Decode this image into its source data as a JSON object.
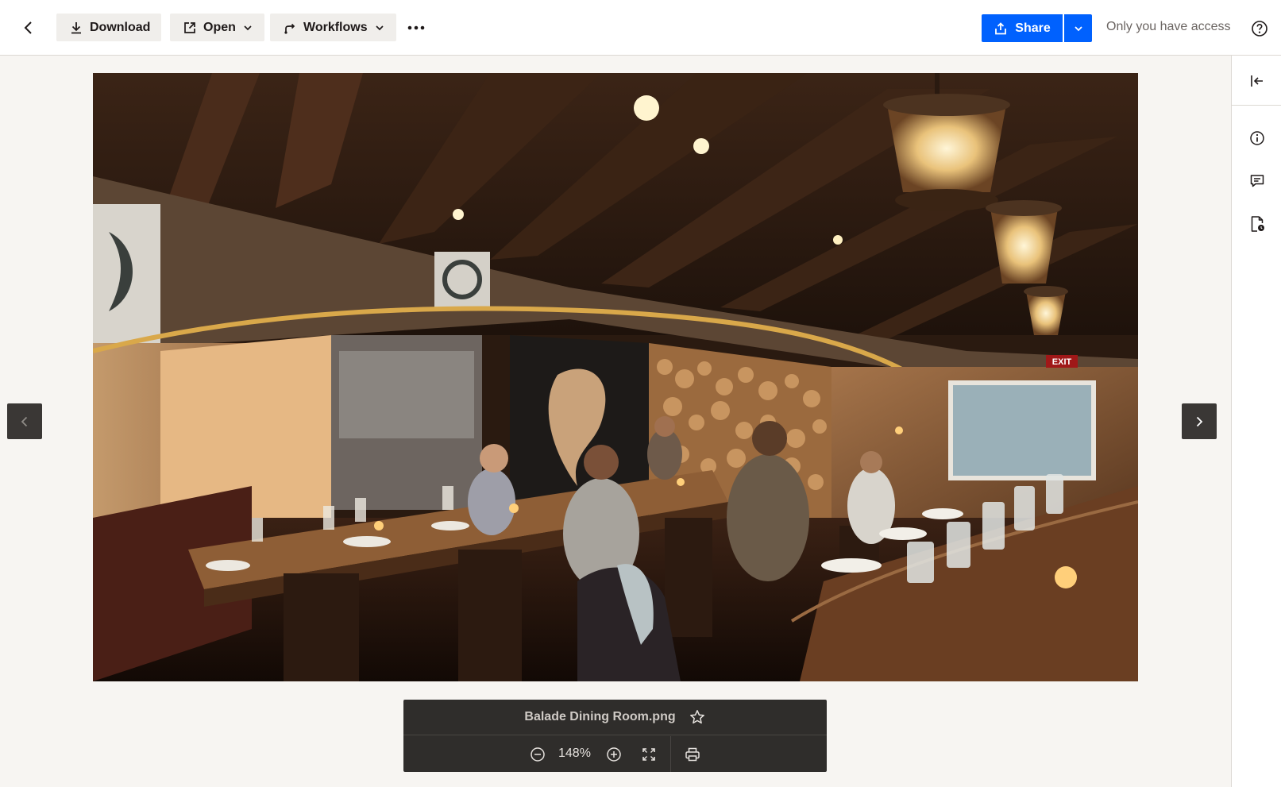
{
  "toolbar": {
    "download_label": "Download",
    "open_label": "Open",
    "workflows_label": "Workflows",
    "share_label": "Share",
    "access_text": "Only you have access"
  },
  "icons": {
    "back": "chevron-left-icon",
    "download": "download-icon",
    "open": "open-external-icon",
    "workflows": "workflows-icon",
    "more": "more-horizontal-icon",
    "share": "share-upload-icon",
    "help": "help-icon",
    "collapse": "collapse-panel-icon",
    "info": "info-icon",
    "comment": "comment-icon",
    "file_activity": "file-activity-icon"
  },
  "preview": {
    "filename": "Balade Dining Room.png",
    "zoom": "148%"
  },
  "colors": {
    "accent": "#0061fe",
    "toolbar_button_bg": "#f0eeeb",
    "viewer_bg": "#f7f5f2",
    "control_bar_bg": "#2f2d2b"
  }
}
